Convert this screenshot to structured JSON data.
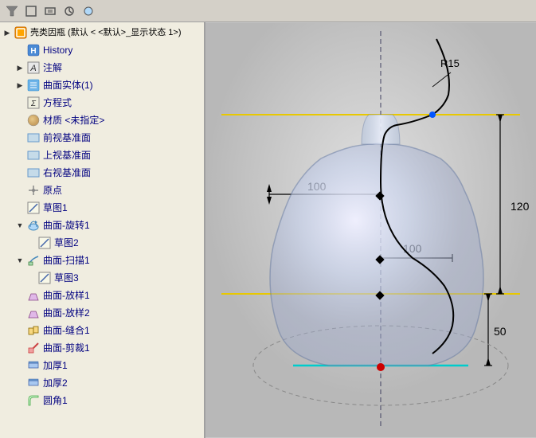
{
  "toolbar": {
    "filter_icon": "▽",
    "icons": [
      "▽",
      "◻",
      "◻",
      "◻",
      "◻"
    ]
  },
  "header": {
    "label": "壳类因瓶 (默认 < <默认>_显示状态 1>)"
  },
  "tree": {
    "items": [
      {
        "id": "shell-feature",
        "indent": 0,
        "expand": "▶",
        "icon": "shell",
        "label": "壳类因瓶 (默认 < <默认>_显示状态 1>)",
        "color": "black"
      },
      {
        "id": "history",
        "indent": 1,
        "expand": "",
        "icon": "history",
        "label": "History",
        "color": "blue"
      },
      {
        "id": "annotation",
        "indent": 1,
        "expand": "▶",
        "icon": "annotation",
        "label": "注解",
        "color": "blue"
      },
      {
        "id": "solid-body",
        "indent": 1,
        "expand": "▶",
        "icon": "solid",
        "label": "曲面实体(1)",
        "color": "blue"
      },
      {
        "id": "formula",
        "indent": 1,
        "expand": "",
        "icon": "formula",
        "label": "方程式",
        "color": "blue"
      },
      {
        "id": "material",
        "indent": 1,
        "expand": "",
        "icon": "material",
        "label": "材质 <未指定>",
        "color": "blue"
      },
      {
        "id": "front-plane",
        "indent": 1,
        "expand": "",
        "icon": "plane",
        "label": "前视基准面",
        "color": "blue"
      },
      {
        "id": "top-plane",
        "indent": 1,
        "expand": "",
        "icon": "plane",
        "label": "上视基准面",
        "color": "blue"
      },
      {
        "id": "right-plane",
        "indent": 1,
        "expand": "",
        "icon": "plane",
        "label": "右视基准面",
        "color": "blue"
      },
      {
        "id": "origin",
        "indent": 1,
        "expand": "",
        "icon": "origin",
        "label": "原点",
        "color": "blue"
      },
      {
        "id": "sketch1",
        "indent": 1,
        "expand": "",
        "icon": "sketch",
        "label": "草图1",
        "color": "blue"
      },
      {
        "id": "revolve",
        "indent": 1,
        "expand": "▼",
        "icon": "revolve",
        "label": "曲面-旋转1",
        "color": "blue"
      },
      {
        "id": "sketch2",
        "indent": 2,
        "expand": "",
        "icon": "sketch",
        "label": "草图2",
        "color": "blue"
      },
      {
        "id": "sweep",
        "indent": 1,
        "expand": "▼",
        "icon": "sweep",
        "label": "曲面-扫描1",
        "color": "blue"
      },
      {
        "id": "sketch3",
        "indent": 2,
        "expand": "",
        "icon": "sketch",
        "label": "草图3",
        "color": "blue"
      },
      {
        "id": "scale1",
        "indent": 1,
        "expand": "",
        "icon": "scale",
        "label": "曲面-放样1",
        "color": "blue"
      },
      {
        "id": "scale2",
        "indent": 1,
        "expand": "",
        "icon": "scale",
        "label": "曲面-放样2",
        "color": "blue"
      },
      {
        "id": "combine1",
        "indent": 1,
        "expand": "",
        "icon": "combine",
        "label": "曲面-缝合1",
        "color": "blue"
      },
      {
        "id": "trim1",
        "indent": 1,
        "expand": "",
        "icon": "trim",
        "label": "曲面-剪裁1",
        "color": "blue"
      },
      {
        "id": "thicken1",
        "indent": 1,
        "expand": "",
        "icon": "thicken",
        "label": "加厚1",
        "color": "blue"
      },
      {
        "id": "thicken2",
        "indent": 1,
        "expand": "",
        "icon": "thicken",
        "label": "加厚2",
        "color": "blue"
      },
      {
        "id": "fillet1",
        "indent": 1,
        "expand": "",
        "icon": "fillet",
        "label": "圆角1",
        "color": "blue"
      }
    ]
  },
  "canvas": {
    "dim_r15": "R15",
    "dim_100_left": "100",
    "dim_100_right": "100",
    "dim_120": "120",
    "dim_50": "50"
  }
}
